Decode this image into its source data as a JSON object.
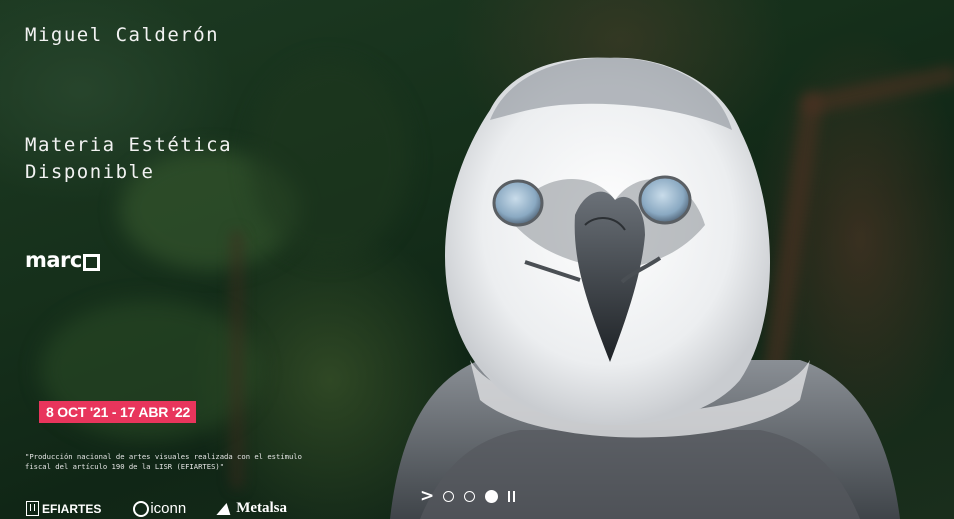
{
  "hero": {
    "artist": "Miguel Calderón",
    "exhibition_title_line1": "Materia Estética",
    "exhibition_title_line2": "Disponible",
    "divider": "____________________",
    "logo_text": "marc",
    "logo_icon": "square-o-icon"
  },
  "date_badge": {
    "text": "8 OCT '21 - 17 ABR '22",
    "color": "#e8355c"
  },
  "fiscal_note": {
    "text": "\"Producción nacional de artes visuales realizada con el estímulo fiscal del artículo 190 de la LISR (EFIARTES)\""
  },
  "sponsors": [
    {
      "name": "EFIARTES",
      "icon": "efiartes-logo-icon"
    },
    {
      "name": "iconn",
      "icon": "iconn-ring-icon"
    },
    {
      "name": "Metalsa",
      "icon": "metalsa-logo-icon"
    }
  ],
  "slider": {
    "next_icon": "chevron-right-icon",
    "dots": 3,
    "active_dot": 3,
    "pause_icon": "pause-icon"
  },
  "image": {
    "subject": "harpy-eagle-photo"
  }
}
